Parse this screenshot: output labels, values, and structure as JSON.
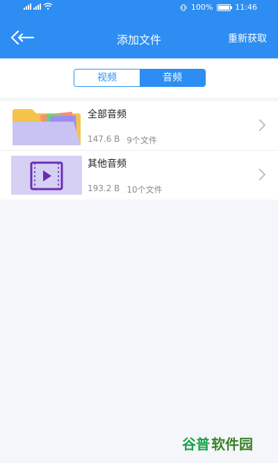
{
  "status_bar": {
    "battery_percent": "100%",
    "time": "11:46",
    "icons": [
      "signal-icon",
      "wifi-icon",
      "vibrate-icon",
      "battery-icon"
    ]
  },
  "header": {
    "title": "添加文件",
    "refresh_label": "重新获取",
    "back_icon": "back-arrow-icon",
    "bg_color": "#2d8df3"
  },
  "tabs": [
    {
      "label": "视频",
      "active": false
    },
    {
      "label": "音频",
      "active": true
    }
  ],
  "folders": [
    {
      "title": "全部音频",
      "size": "147.6 B",
      "count": "9个文件",
      "icon": "folder-icon"
    },
    {
      "title": "其他音频",
      "size": "193.2 B",
      "count": "10个文件",
      "icon": "video-file-icon"
    }
  ],
  "watermark": {
    "text": "谷普软件园"
  }
}
